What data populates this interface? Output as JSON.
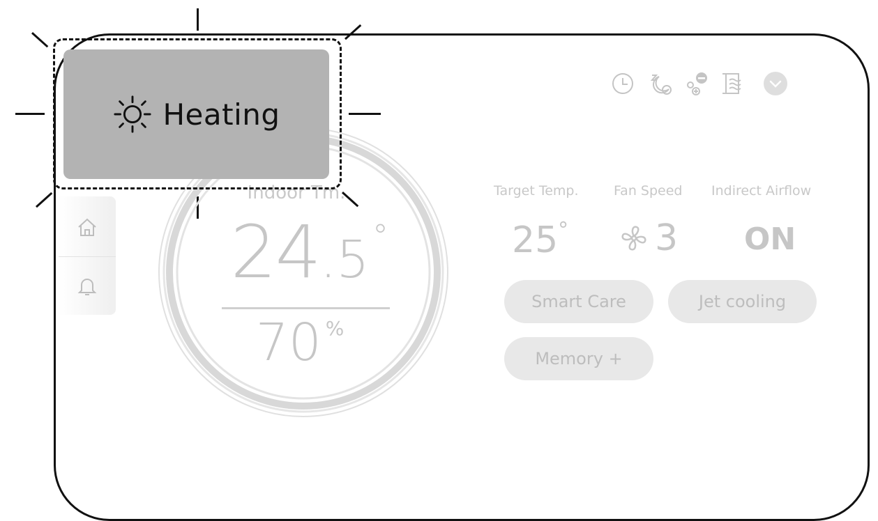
{
  "mode": {
    "label": "Heating",
    "icon": "sun-icon"
  },
  "sidebar": {
    "items": [
      {
        "icon": "home-icon"
      },
      {
        "icon": "bell-icon"
      }
    ]
  },
  "top_icons": [
    "clock-icon",
    "sleep-timer-icon",
    "airflow-toggle-icon",
    "vane-icon",
    "chevron-down-icon"
  ],
  "dial": {
    "label": "Indoor Tm.",
    "temp_int": "24",
    "temp_dec": ".5",
    "temp_deg": "°",
    "humidity": "70",
    "humidity_unit": "%"
  },
  "status": {
    "target_temp": {
      "label": "Target Temp.",
      "value": "25",
      "unit": "°"
    },
    "fan_speed": {
      "label": "Fan Speed",
      "value": "3",
      "icon": "fan-icon"
    },
    "indirect_airflow": {
      "label": "Indirect Airflow",
      "value": "ON"
    }
  },
  "buttons": {
    "smart_care": "Smart Care",
    "jet_cooling": "Jet cooling",
    "memory_plus": "Memory +"
  },
  "colors": {
    "highlight_fill": "#b3b3b3",
    "faded_text": "#c6c6c6",
    "pill_fill": "#e8e8e8"
  }
}
